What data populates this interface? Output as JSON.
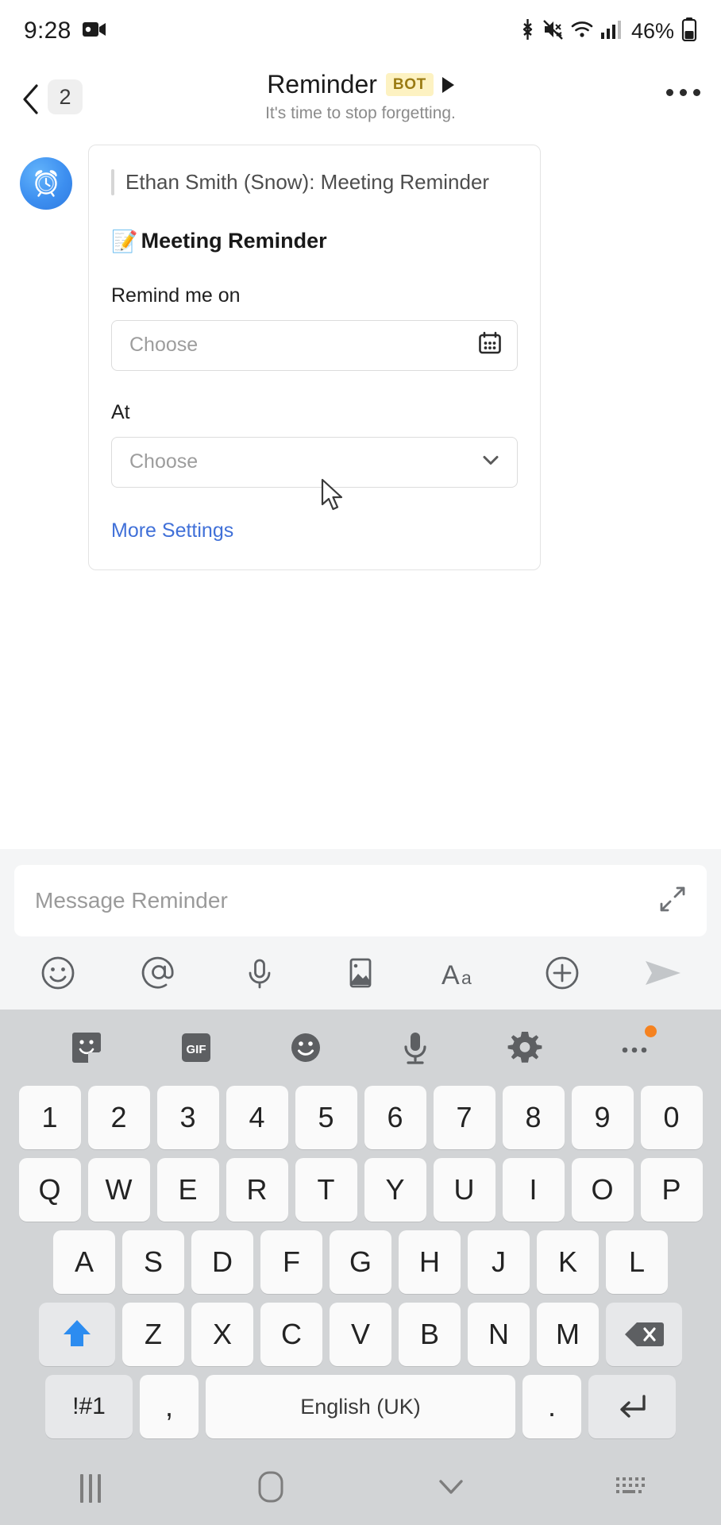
{
  "status_bar": {
    "time": "9:28",
    "battery_percent": "46%",
    "icons": [
      "video-recording-icon",
      "bluetooth-icon",
      "mute-vibrate-icon",
      "wifi-icon",
      "cellular-signal-icon",
      "battery-icon"
    ]
  },
  "header": {
    "back_label": "back-chevron",
    "unread_count": "2",
    "title": "Reminder",
    "bot_badge": "BOT",
    "subtitle": "It's time to stop forgetting.",
    "bot_badge_bg": "#fdf2c2",
    "bot_badge_fg": "#9a7b13",
    "overflow_label": "more-options"
  },
  "message_card": {
    "avatar_icon": "alarm-clock-icon",
    "quote": "Ethan Smith (Snow): Meeting Reminder",
    "title_emoji": "📝",
    "title": "Meeting Reminder",
    "fields": [
      {
        "label": "Remind me on",
        "placeholder": "Choose",
        "trailing_icon": "calendar-icon"
      },
      {
        "label": "At",
        "placeholder": "Choose",
        "trailing_icon": "chevron-down-icon"
      }
    ],
    "more_settings": "More Settings",
    "link_color": "#4070d8"
  },
  "composer": {
    "placeholder": "Message Reminder",
    "expand_icon": "expand-icon",
    "tools": [
      "emoji-icon",
      "mention-icon",
      "microphone-icon",
      "image-icon",
      "text-format-icon",
      "add-icon"
    ],
    "send_icon": "send-icon"
  },
  "keyboard": {
    "toolbar": [
      "sticker-icon",
      "gif-icon",
      "emoji-icon",
      "microphone-icon",
      "settings-gear-icon",
      "more-icon"
    ],
    "more_badge_color": "#f58220",
    "rows": {
      "digits": [
        "1",
        "2",
        "3",
        "4",
        "5",
        "6",
        "7",
        "8",
        "9",
        "0"
      ],
      "row1": [
        "Q",
        "W",
        "E",
        "R",
        "T",
        "Y",
        "U",
        "I",
        "O",
        "P"
      ],
      "row2": [
        "A",
        "S",
        "D",
        "F",
        "G",
        "H",
        "J",
        "K",
        "L"
      ],
      "row3": [
        "Z",
        "X",
        "C",
        "V",
        "B",
        "N",
        "M"
      ]
    },
    "shift_label": "shift-up-icon",
    "shift_color": "#2c8cf0",
    "backspace_label": "backspace-icon",
    "symbols_key": "!#1",
    "comma_key": ",",
    "space_key": "English (UK)",
    "period_key": ".",
    "enter_label": "enter-icon"
  },
  "nav_bar": {
    "recents": "recents-icon",
    "home": "home-icon",
    "back": "hide-keyboard-icon",
    "keyboard": "keyboard-switch-icon"
  }
}
